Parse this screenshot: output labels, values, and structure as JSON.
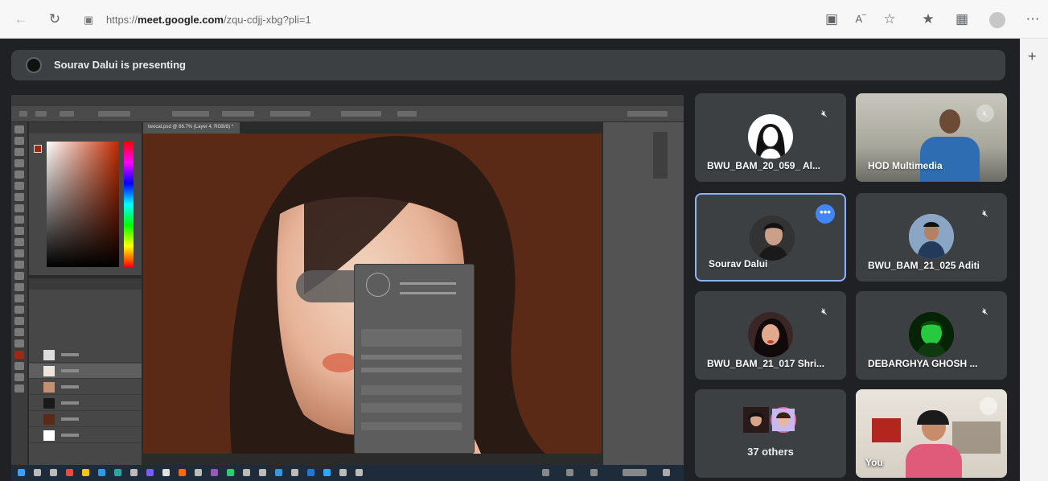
{
  "browser": {
    "url_prefix": "https://",
    "url_domain": "meet.google.com",
    "url_path": "/zqu-cdjj-xbg?pli=1",
    "icons": [
      "back-icon",
      "reload-icon",
      "lock-icon",
      "camera-icon",
      "read-aloud-icon",
      "favorite-add-icon",
      "favorites-icon",
      "collections-icon",
      "profile-icon",
      "more-icon"
    ],
    "new_tab": "+"
  },
  "meet": {
    "presenting_text": "Sourav Dalui is presenting",
    "participants": [
      {
        "name": "BWU_BAM_20_059_ Al...",
        "muted": true
      },
      {
        "name": "HOD Multimedia",
        "muted": true
      },
      {
        "name": "Sourav Dalui",
        "active": true
      },
      {
        "name": "BWU_BAM_21_025 Aditi",
        "muted": true
      },
      {
        "name": "BWU_BAM_21_017 Shri...",
        "muted": true
      },
      {
        "name": "DEBARGHYA GHOSH ...",
        "muted": true
      }
    ],
    "others_label": "37 others",
    "self_label": "You",
    "more_label": "•••"
  },
  "photoshop": {
    "doc_tab": "twocat.psd @ 66.7% (Layer 4, RGB/8) *"
  },
  "colors": {
    "meet_bg": "#202124",
    "tile_bg": "#3c4043",
    "active_border": "#8ab4f8",
    "more_btn": "#4285f4",
    "canvas_bg": "#5a2a16"
  }
}
